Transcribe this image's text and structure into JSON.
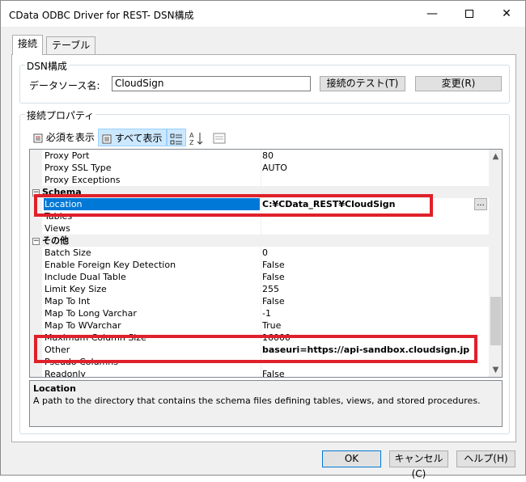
{
  "window": {
    "title": "CData ODBC Driver for REST- DSN構成",
    "minimize": "—",
    "close": "✕"
  },
  "tabs": [
    {
      "label": "接続",
      "active": true
    },
    {
      "label": "テーブル",
      "active": false
    }
  ],
  "dsn": {
    "legend": "DSN構成",
    "source_label": "データソース名:",
    "source_value": "CloudSign",
    "test_button": "接続のテスト(T)",
    "change_button": "変更(R)"
  },
  "props": {
    "legend": "接続プロパティ",
    "required_button": "必須を表示",
    "all_button": "すべて表示"
  },
  "grid": {
    "rows": [
      {
        "name": "Proxy Port",
        "value": "80"
      },
      {
        "name": "Proxy SSL Type",
        "value": "AUTO"
      },
      {
        "name": "Proxy Exceptions",
        "value": ""
      },
      {
        "name": "Schema",
        "value": "",
        "category": true
      },
      {
        "name": "Location",
        "value": "C:¥CData_REST¥CloudSign",
        "selected": true
      },
      {
        "name": "Tables",
        "value": ""
      },
      {
        "name": "Views",
        "value": ""
      },
      {
        "name": "その他",
        "value": "",
        "category": true
      },
      {
        "name": "Batch Size",
        "value": "0"
      },
      {
        "name": "Enable Foreign Key Detection",
        "value": "False"
      },
      {
        "name": "Include Dual Table",
        "value": "False"
      },
      {
        "name": "Limit Key Size",
        "value": "255"
      },
      {
        "name": "Map To Int",
        "value": "False"
      },
      {
        "name": "Map To Long Varchar",
        "value": "-1"
      },
      {
        "name": "Map To WVarchar",
        "value": "True"
      },
      {
        "name": "Maximum Column Size",
        "value": "16000"
      },
      {
        "name": "Other",
        "value": "baseuri=https://api-sandbox.cloudsign.jp"
      },
      {
        "name": "Pseudo Columns",
        "value": ""
      },
      {
        "name": "Readonly",
        "value": "False"
      }
    ],
    "ellipsis": "..."
  },
  "description": {
    "title": "Location",
    "text": "A path to the directory that contains the schema files defining tables, views, and stored procedures."
  },
  "footer": {
    "ok": "OK",
    "cancel": "キャンセル(C)",
    "help": "ヘルプ(H)"
  },
  "colors": {
    "selection": "#0078d7",
    "highlight_box": "#e0202a"
  }
}
